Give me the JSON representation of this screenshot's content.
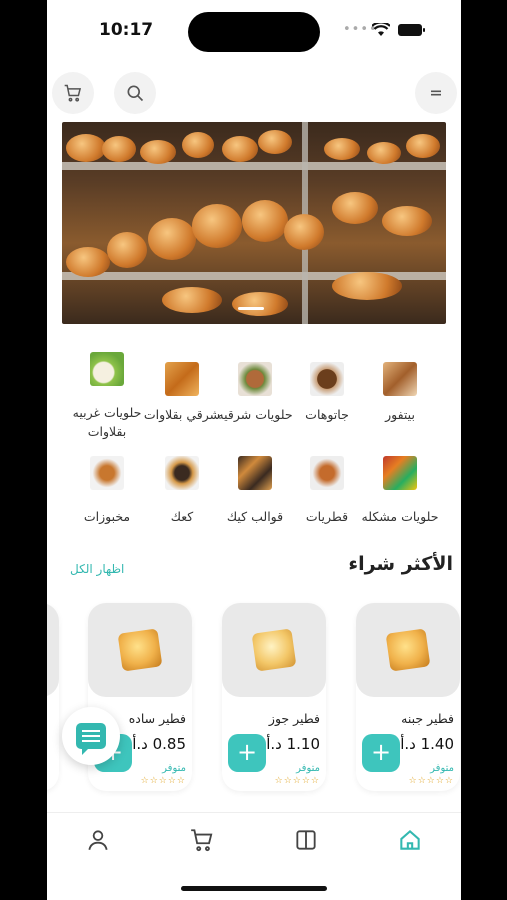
{
  "status_bar": {
    "time": "10:17"
  },
  "categories": [
    {
      "label": "بيتفور",
      "icon": "petit-four-image"
    },
    {
      "label": "جاتوهات",
      "icon": "cake-image"
    },
    {
      "label": "حلويات شرقيه",
      "icon": "eastern-sweets-image"
    },
    {
      "label": "شرقي بقلاوات",
      "icon": "baklava-image"
    },
    {
      "label": "حلويات غربيه بقلاوات",
      "icon": "western-sweets-image"
    },
    {
      "label": "حلويات مشكله",
      "icon": "mixed-sweets-image"
    },
    {
      "label": "قطريات",
      "icon": "qatari-sweets-image"
    },
    {
      "label": "قوالب كيك",
      "icon": "cake-molds-image"
    },
    {
      "label": "كعك",
      "icon": "kaak-image"
    },
    {
      "label": "مخبوزات",
      "icon": "baked-goods-image"
    }
  ],
  "section": {
    "title": "الأكثر شراء",
    "show_all": "اظهار الكل"
  },
  "products": [
    {
      "name": "فطير جبنه",
      "price": "1.40 د.أ",
      "availability": "متوفر",
      "stars": "☆☆☆☆☆"
    },
    {
      "name": "فطير جوز",
      "price": "1.10 د.أ",
      "availability": "متوفر",
      "stars": "☆☆☆☆☆"
    },
    {
      "name": "فطير ساده",
      "price": "0.85 د.أ",
      "availability": "متوفر",
      "stars": "☆☆☆☆☆"
    }
  ],
  "add_label": "+",
  "colors": {
    "accent": "#3ec5bd",
    "link": "#33b8b0"
  }
}
